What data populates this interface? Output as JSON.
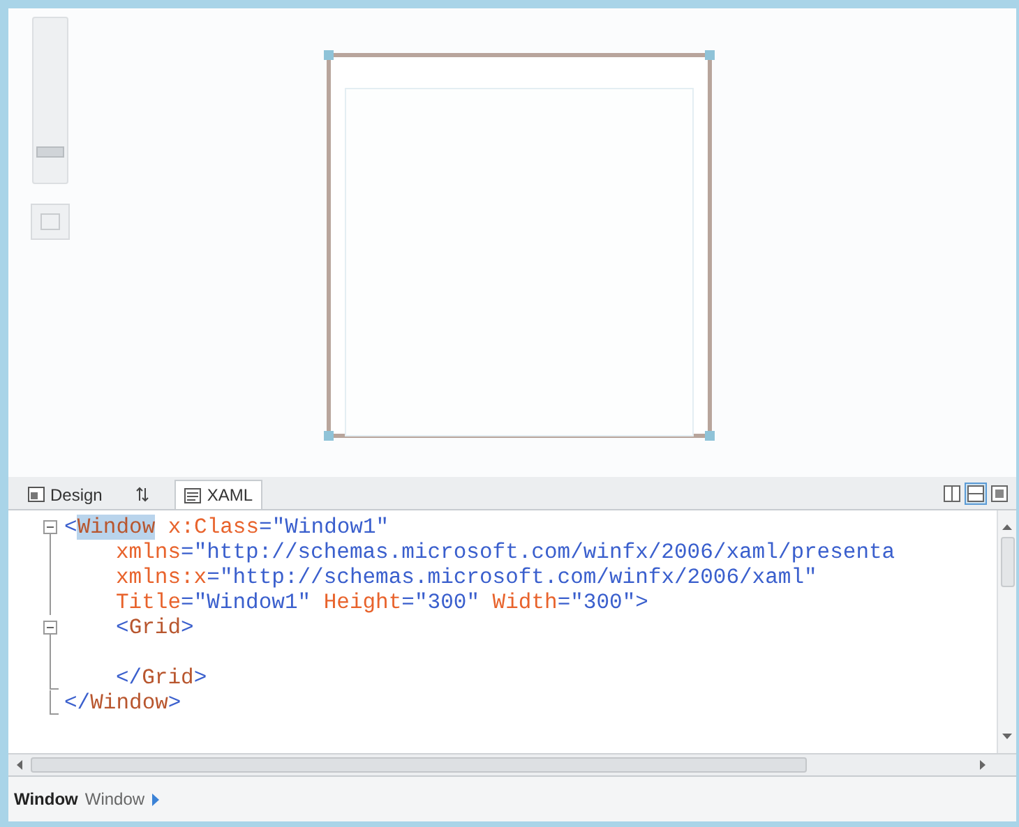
{
  "designer": {
    "zoom": {
      "level": 0.15
    }
  },
  "tabs": [
    {
      "label": "Design",
      "kind": "design",
      "selected": false
    },
    {
      "label": "XAML",
      "kind": "xaml",
      "selected": true
    }
  ],
  "view_buttons": [
    {
      "kind": "vertical",
      "selected": false
    },
    {
      "kind": "horizontal",
      "selected": true
    },
    {
      "kind": "single",
      "selected": false
    }
  ],
  "code_lines": [
    {
      "kind": "fold_start",
      "indented": false,
      "tokens": [
        {
          "kind": "delim",
          "text": "<"
        },
        {
          "kind": "element",
          "text": "Window",
          "selected": true
        },
        {
          "kind": "attribute",
          "text": " x:Class"
        },
        {
          "kind": "delim",
          "text": "="
        },
        {
          "kind": "value",
          "text": "\"Window1\""
        }
      ]
    },
    {
      "kind": "fold_body",
      "indented": true,
      "tokens": [
        {
          "kind": "attribute",
          "text": "xmlns"
        },
        {
          "kind": "delim",
          "text": "="
        },
        {
          "kind": "value",
          "text": "\"http://schemas.microsoft.com/winfx/2006/xaml/presenta"
        }
      ]
    },
    {
      "kind": "fold_body",
      "indented": true,
      "tokens": [
        {
          "kind": "attribute",
          "text": "xmlns:x"
        },
        {
          "kind": "delim",
          "text": "="
        },
        {
          "kind": "value",
          "text": "\"http://schemas.microsoft.com/winfx/2006/xaml\""
        }
      ]
    },
    {
      "kind": "fold_body",
      "indented": true,
      "tokens": [
        {
          "kind": "attribute",
          "text": "Title"
        },
        {
          "kind": "delim",
          "text": "="
        },
        {
          "kind": "value",
          "text": "\"Window1\""
        },
        {
          "kind": "attribute",
          "text": " Height"
        },
        {
          "kind": "delim",
          "text": "="
        },
        {
          "kind": "value",
          "text": "\"300\""
        },
        {
          "kind": "attribute",
          "text": " Width"
        },
        {
          "kind": "delim",
          "text": "="
        },
        {
          "kind": "value",
          "text": "\"300\""
        },
        {
          "kind": "delim",
          "text": ">"
        }
      ]
    },
    {
      "kind": "fold_start",
      "indented": true,
      "tokens": [
        {
          "kind": "delim",
          "text": "<"
        },
        {
          "kind": "element",
          "text": "Grid",
          "selected": false
        },
        {
          "kind": "delim",
          "text": ">"
        }
      ]
    },
    {
      "kind": "fold_body"
    },
    {
      "kind": "fold_end",
      "indented": true,
      "tokens": [
        {
          "kind": "delim",
          "text": "</"
        },
        {
          "kind": "element",
          "text": "Grid",
          "selected": false
        },
        {
          "kind": "delim",
          "text": ">"
        }
      ]
    },
    {
      "kind": "fold_end",
      "indented": false,
      "tokens": [
        {
          "kind": "delim",
          "text": "</"
        },
        {
          "kind": "element",
          "text": "Window",
          "selected": false
        },
        {
          "kind": "delim",
          "text": ">"
        }
      ]
    }
  ],
  "status_bar": {
    "breadcrumbs": [
      {
        "label": "Window",
        "selected": true
      },
      {
        "label": "Window",
        "selected": false
      }
    ]
  }
}
